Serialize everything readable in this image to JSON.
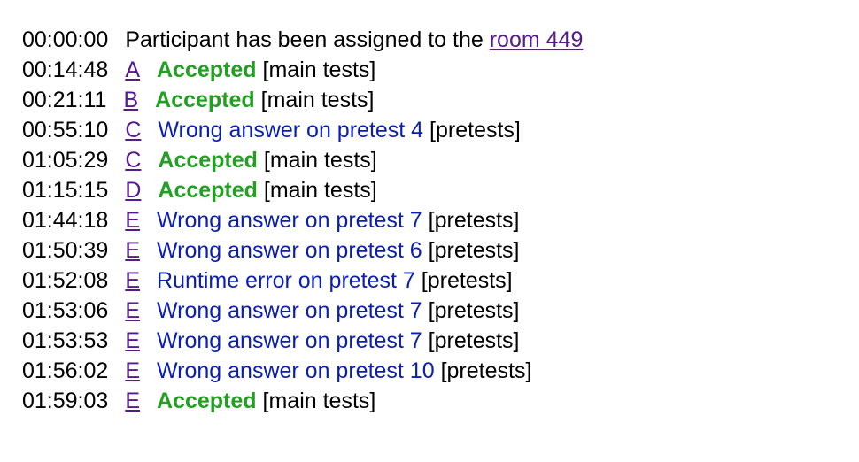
{
  "colors": {
    "accepted": "#22a022",
    "rejected": "#0a1eb4",
    "link": "#551a8b"
  },
  "assignment": {
    "time": "00:00:00",
    "text": "Participant has been assigned to the",
    "room_link": "room 449"
  },
  "submissions": [
    {
      "time": "00:14:48",
      "problem": "A",
      "verdict": "Accepted",
      "ok": true,
      "suffix": "[main tests]"
    },
    {
      "time": "00:21:11",
      "problem": "B",
      "verdict": "Accepted",
      "ok": true,
      "suffix": "[main tests]"
    },
    {
      "time": "00:55:10",
      "problem": "C",
      "verdict": "Wrong answer on pretest 4",
      "ok": false,
      "suffix": "[pretests]"
    },
    {
      "time": "01:05:29",
      "problem": "C",
      "verdict": "Accepted",
      "ok": true,
      "suffix": "[main tests]"
    },
    {
      "time": "01:15:15",
      "problem": "D",
      "verdict": "Accepted",
      "ok": true,
      "suffix": "[main tests]"
    },
    {
      "time": "01:44:18",
      "problem": "E",
      "verdict": "Wrong answer on pretest 7",
      "ok": false,
      "suffix": "[pretests]"
    },
    {
      "time": "01:50:39",
      "problem": "E",
      "verdict": "Wrong answer on pretest 6",
      "ok": false,
      "suffix": "[pretests]"
    },
    {
      "time": "01:52:08",
      "problem": "E",
      "verdict": "Runtime error on pretest 7",
      "ok": false,
      "suffix": "[pretests]"
    },
    {
      "time": "01:53:06",
      "problem": "E",
      "verdict": "Wrong answer on pretest 7",
      "ok": false,
      "suffix": "[pretests]"
    },
    {
      "time": "01:53:53",
      "problem": "E",
      "verdict": "Wrong answer on pretest 7",
      "ok": false,
      "suffix": "[pretests]"
    },
    {
      "time": "01:56:02",
      "problem": "E",
      "verdict": "Wrong answer on pretest 10",
      "ok": false,
      "suffix": "[pretests]"
    },
    {
      "time": "01:59:03",
      "problem": "E",
      "verdict": "Accepted",
      "ok": true,
      "suffix": "[main tests]"
    }
  ]
}
